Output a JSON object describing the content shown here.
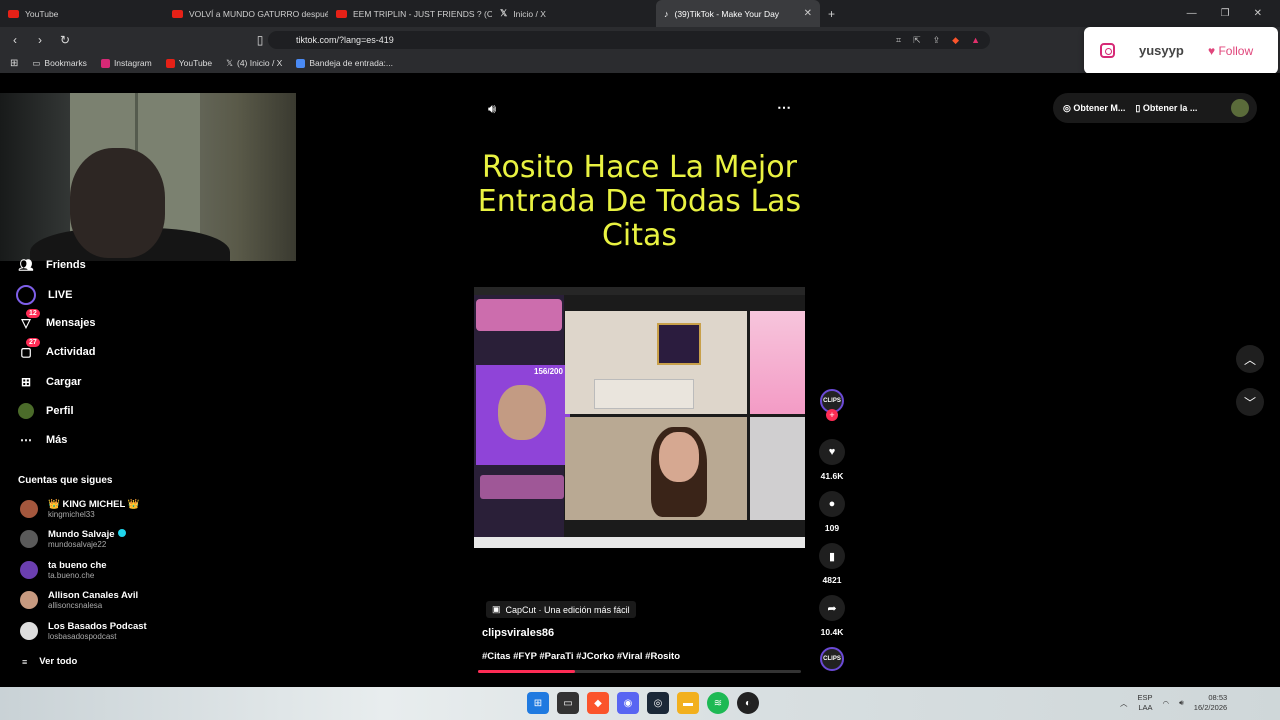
{
  "browser": {
    "tabs": [
      {
        "label": "YouTube",
        "icon": "youtube-icon"
      },
      {
        "label": "VOLVÍ a MUNDO GATURRO despué…",
        "icon": "youtube-icon"
      },
      {
        "label": "EEM TRIPLIN - JUST FRIENDS ? (OFF…",
        "icon": "youtube-icon"
      },
      {
        "label": "Inicio / X",
        "icon": "x-icon"
      },
      {
        "label": "(39)TikTok - Make Your Day",
        "icon": "tiktok-icon",
        "active": true
      }
    ],
    "new_tab": "+",
    "url": "tiktok.com/?lang=es-419",
    "bookmarks": [
      {
        "label": "Bookmarks"
      },
      {
        "label": "Instagram"
      },
      {
        "label": "YouTube"
      },
      {
        "label": "(4) Inicio / X"
      },
      {
        "label": "Bandeja de entrada:..."
      }
    ]
  },
  "popup": {
    "username": "yusyyp",
    "follow_label": "Follow"
  },
  "sidebar": {
    "items": [
      {
        "label": "Friends",
        "icon": "friends-icon"
      },
      {
        "label": "LIVE",
        "icon": "live-icon"
      },
      {
        "label": "Mensajes",
        "icon": "messages-icon",
        "badge": "12"
      },
      {
        "label": "Actividad",
        "icon": "activity-icon",
        "badge": "27"
      },
      {
        "label": "Cargar",
        "icon": "upload-icon"
      },
      {
        "label": "Perfil",
        "icon": "profile-icon"
      },
      {
        "label": "Más",
        "icon": "more-icon"
      }
    ],
    "following_title": "Cuentas que sigues",
    "following": [
      {
        "name": "KING MICHEL",
        "handle": "kingmichel33"
      },
      {
        "name": "Mundo Salvaje",
        "handle": "mundosalvaje22",
        "verified": true
      },
      {
        "name": "ta bueno che",
        "handle": "ta.bueno.che"
      },
      {
        "name": "Allison Canales Avil",
        "handle": "allisoncsnalesa"
      },
      {
        "name": "Los Basados Podcast",
        "handle": "losbasadospodcast"
      }
    ],
    "see_all": "Ver todo"
  },
  "topright": {
    "get_app": "Obtener M...",
    "get_desktop": "Obtener la ..."
  },
  "video": {
    "title": "Rosito Hace La Mejor Entrada De Todas Las Citas",
    "capcut": "CapCut · Una edición más fácil",
    "author": "clipsvirales86",
    "tags": "#Citas #FYP #ParaTi  #JCorko #Viral #Rosito",
    "progress": 0.3,
    "overlay_count": "156/200"
  },
  "actions": {
    "clips_label": "CLIPS",
    "likes": "41.6K",
    "comments": "109",
    "saves": "4821",
    "shares": "10.4K"
  },
  "taskbar": {
    "lang1": "ESP",
    "lang2": "LAA",
    "time": "08:53",
    "date": "16/2/2026"
  },
  "colors": {
    "accent": "#fe2c55",
    "title_yellow": "#e9f241"
  }
}
